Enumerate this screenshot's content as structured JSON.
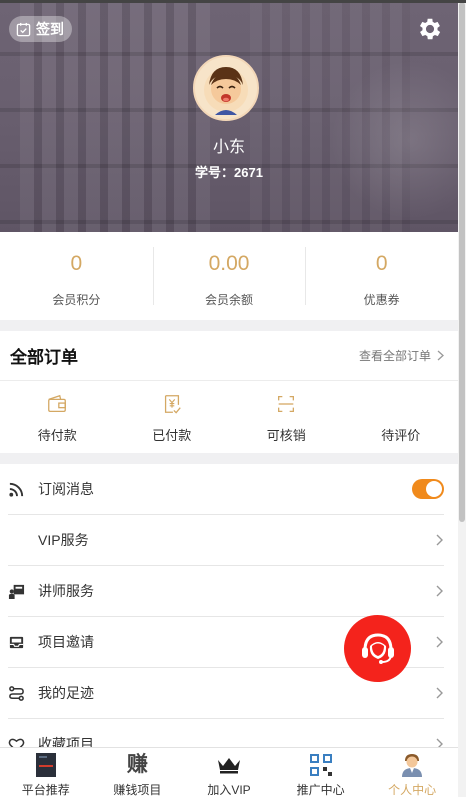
{
  "header": {
    "signin_label": "签到",
    "nickname": "小东",
    "student_no": "学号：2671",
    "icons": {
      "signin": "calendar-check-icon",
      "settings": "gear-icon",
      "avatar": "avatar-cartoon"
    }
  },
  "stats": [
    {
      "value": "0",
      "label": "会员积分"
    },
    {
      "value": "0.00",
      "label": "会员余额"
    },
    {
      "value": "0",
      "label": "优惠券"
    }
  ],
  "orders": {
    "title": "全部订单",
    "view_all": "查看全部订单",
    "items": [
      {
        "label": "待付款",
        "icon": "wallet-icon"
      },
      {
        "label": "已付款",
        "icon": "paid-yen-icon"
      },
      {
        "label": "可核销",
        "icon": "scan-icon"
      },
      {
        "label": "待评价",
        "icon": ""
      }
    ]
  },
  "menu": [
    {
      "label": "订阅消息",
      "icon": "rss-icon",
      "toggle": true
    },
    {
      "label": "VIP服务",
      "icon": ""
    },
    {
      "label": "讲师服务",
      "icon": "teacher-icon"
    },
    {
      "label": "项目邀请",
      "icon": "inbox-icon"
    },
    {
      "label": "我的足迹",
      "icon": "route-icon"
    },
    {
      "label": "收藏项目",
      "icon": "heart-icon"
    }
  ],
  "fab": {
    "icon": "customer-service-headset-icon"
  },
  "tabbar": [
    {
      "label": "平台推荐",
      "icon": "book-thumb-icon"
    },
    {
      "label": "赚钱项目",
      "glyph": "赚"
    },
    {
      "label": "加入VIP",
      "icon": "crown-icon"
    },
    {
      "label": "推广中心",
      "icon": "qrcode-icon"
    },
    {
      "label": "个人中心",
      "icon": "person-icon",
      "active": true
    }
  ],
  "colors": {
    "accent": "#d4a863",
    "toggle": "#f08a1c",
    "fab": "#f4231c"
  }
}
